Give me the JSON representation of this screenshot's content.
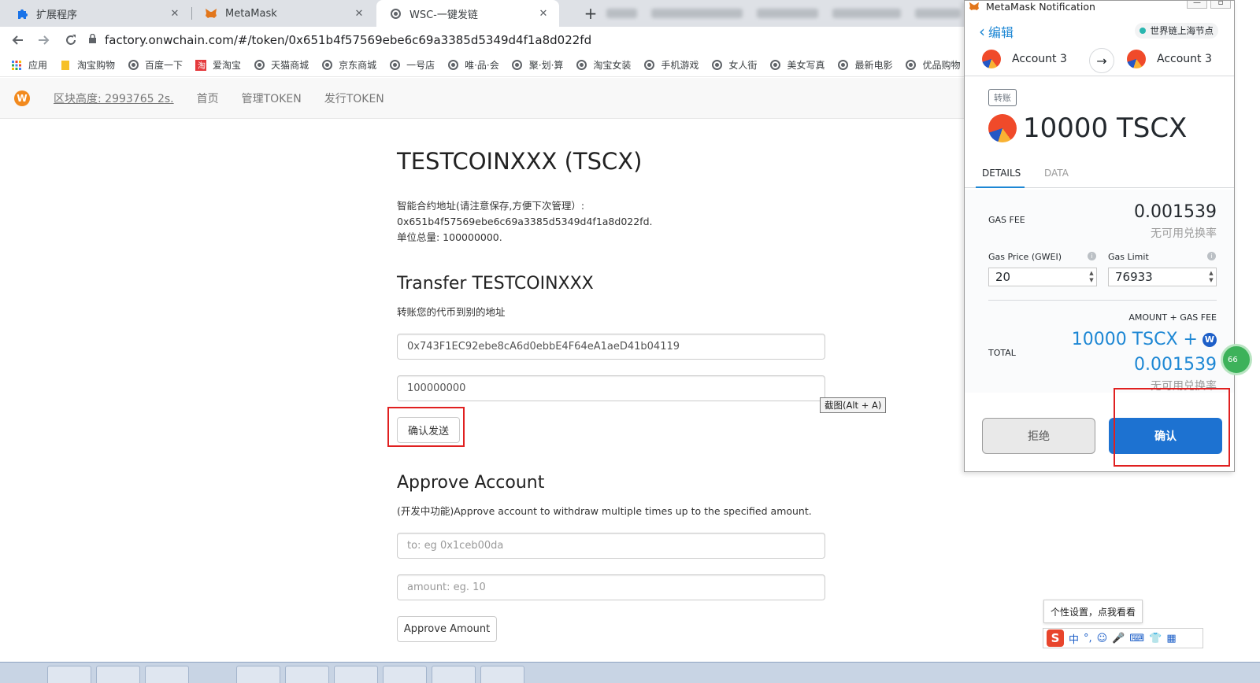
{
  "browser": {
    "tabs": [
      {
        "title": "扩展程序",
        "icon": "puzzle-icon"
      },
      {
        "title": "MetaMask",
        "icon": "fox-icon"
      },
      {
        "title": "WSC-一键发链",
        "icon": "globe-icon"
      }
    ],
    "new_tab": "+",
    "url": "factory.onwchain.com/#/token/0x651b4f57569ebe6c69a3385d5349d4f1a8d022fd",
    "bookmarks": [
      "应用",
      "淘宝购物",
      "百度一下",
      "爱淘宝",
      "天猫商城",
      "京东商城",
      "一号店",
      "唯·品·会",
      "聚·划·算",
      "淘宝女装",
      "手机游戏",
      "女人街",
      "美女写真",
      "最新电影",
      "优品购物"
    ]
  },
  "site_nav": {
    "logo": "W",
    "block_height": "区块高度: 2993765  2s.",
    "links": [
      "首页",
      "管理TOKEN",
      "发行TOKEN"
    ]
  },
  "token": {
    "title": "TESTCOINXXX (TSCX)",
    "info_lines": [
      "智能合约地址(请注意保存,方便下次管理）:",
      "0x651b4f57569ebe6c69a3385d5349d4f1a8d022fd.",
      "单位总量: 100000000."
    ]
  },
  "transfer": {
    "heading": "Transfer TESTCOINXXX",
    "subtitle": "转账您的代币到别的地址",
    "address_value": "0x743F1EC92ebe8cA6d0ebbE4F64eA1aeD41b04119",
    "amount_value": "100000000",
    "send_button": "确认发送"
  },
  "screenshot_tooltip": "截图(Alt + A)",
  "approve": {
    "heading": "Approve Account",
    "subtitle": "(开发中功能)Approve account to withdraw multiple times up to the specified amount.",
    "to_placeholder": "to: eg 0x1ceb00da",
    "amount_placeholder": "amount: eg. 10",
    "button": "Approve Amount"
  },
  "metamask": {
    "window_title": "MetaMask Notification",
    "back_label": "编辑",
    "network": "世界链上海节点",
    "from_account": "Account 3",
    "to_account": "Account 3",
    "badge": "转账",
    "amount": "10000 TSCX",
    "tabs": [
      "DETAILS",
      "DATA"
    ],
    "gas_fee_label": "GAS FEE",
    "gas_fee_value": "0.001539",
    "no_rate": "无可用兑换率",
    "gas_price_label": "Gas Price (GWEI)",
    "gas_price_value": "20",
    "gas_limit_label": "Gas Limit",
    "gas_limit_value": "76933",
    "amount_gas_label": "AMOUNT + GAS FEE",
    "total_label": "TOTAL",
    "total_line1": "10000 TSCX +",
    "total_line2": "0.001539",
    "total_no_rate": "无可用兑换率",
    "reject_button": "拒绝",
    "confirm_button": "确认",
    "side_badge": "66"
  },
  "ime": {
    "tip": "个性设置，点我看看",
    "logo": "S",
    "items": [
      "中",
      "°,",
      "☺",
      "🎤",
      "⌨",
      "👕",
      "▦"
    ]
  },
  "colors": {
    "accent_blue": "#1d72d1",
    "highlight_red": "#e02020",
    "logo_orange": "#f28a1e"
  }
}
